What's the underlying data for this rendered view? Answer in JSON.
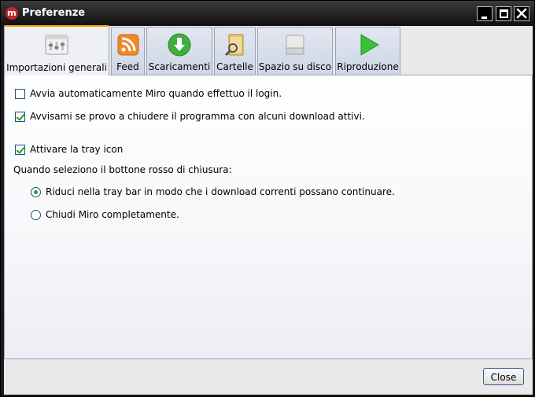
{
  "window": {
    "title": "Preferenze",
    "app_icon_glyph": "m"
  },
  "tabs": [
    {
      "label": "Importazioni generali",
      "icon": "general-settings-icon",
      "active": true
    },
    {
      "label": "Feed",
      "icon": "rss-feed-icon",
      "active": false
    },
    {
      "label": "Scaricamenti",
      "icon": "download-arrow-icon",
      "active": false
    },
    {
      "label": "Cartelle",
      "icon": "folder-icon",
      "active": false
    },
    {
      "label": "Spazio su disco",
      "icon": "hard-disk-icon",
      "active": false
    },
    {
      "label": "Riproduzione",
      "icon": "play-icon",
      "active": false
    }
  ],
  "options": {
    "autostart": {
      "label": "Avvia automaticamente Miro quando effettuo il login.",
      "checked": false
    },
    "warn_on_quit": {
      "label": "Avvisami se provo a chiudere il programma con alcuni download attivi.",
      "checked": true
    },
    "tray_icon": {
      "label": "Attivare la tray icon",
      "checked": true
    },
    "close_button_prompt": "Quando seleziono il bottone rosso di chiusura:",
    "close_choices": [
      {
        "label": "Riduci nella tray bar in modo che i download correnti possano continuare.",
        "selected": true
      },
      {
        "label": "Chiudi Miro completamente.",
        "selected": false
      }
    ]
  },
  "footer": {
    "close_label": "Close"
  },
  "colors": {
    "active_tab_accent": "#f5a300",
    "check_mark": "#21a121",
    "app_icon": "#c3272b"
  }
}
